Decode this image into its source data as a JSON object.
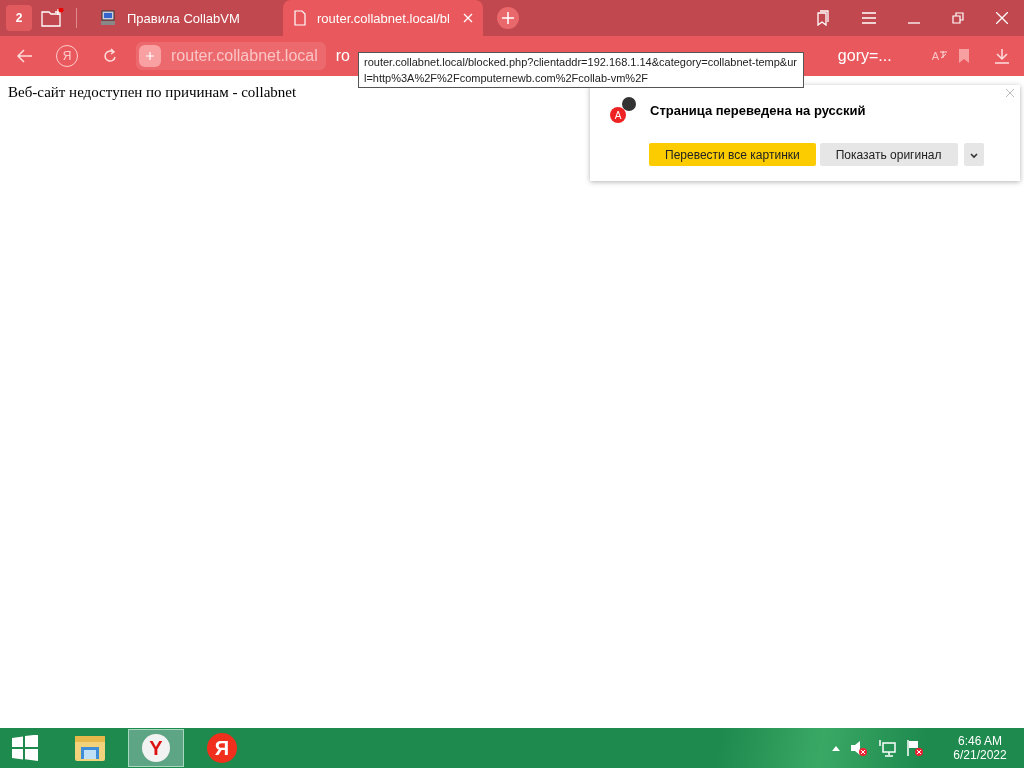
{
  "tab_bar": {
    "tab_counter": "2",
    "tabs": [
      {
        "title": "Правила CollabVM",
        "selected": false,
        "kind": "computer"
      },
      {
        "title": "router.collabnet.local/bl",
        "selected": true,
        "kind": "page"
      }
    ]
  },
  "toolbar": {
    "yandex_button": "Я",
    "domain": "router.collabnet.local",
    "path_start": "ro",
    "path_end": "gory=...",
    "translate_badge": "A"
  },
  "tooltip": {
    "text": "router.collabnet.local/blocked.php?clientaddr=192.168.1.14&category=collabnet-temp&url=http%3A%2F%2Fcomputernewb.com%2Fcollab-vm%2F"
  },
  "page": {
    "text": "Веб-сайт недоступен по причинам - collabnet"
  },
  "translate_popup": {
    "title": "Страница переведена на русский",
    "icon_letter": "A",
    "buttons": [
      {
        "label": "Перевести все картинки",
        "kind": "primary"
      },
      {
        "label": "Показать оригинал",
        "kind": "secondary"
      }
    ]
  },
  "taskbar": {
    "apps": [
      {
        "kind": "explorer",
        "selected": false
      },
      {
        "kind": "browser",
        "letter": "Y",
        "selected": true
      },
      {
        "kind": "yandex",
        "letter": "Я",
        "selected": false
      }
    ],
    "time": "6:46 AM",
    "date": "6/21/2022"
  }
}
